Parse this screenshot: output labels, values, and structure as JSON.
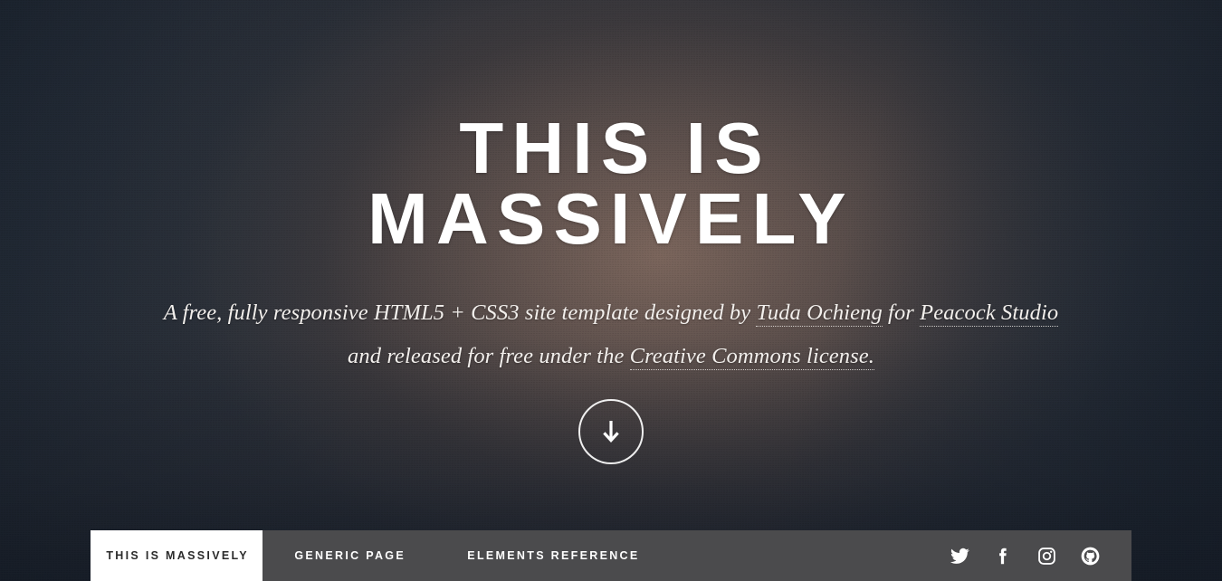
{
  "hero": {
    "title": "THIS IS MASSIVELY",
    "title_line1": "THIS IS",
    "title_line2": "MASSIVELY",
    "subtitle_line1_pre": "A free, fully responsive HTML5 + CSS3 site template designed by ",
    "subtitle_link_author": "Tuda Ochieng",
    "subtitle_line1_mid": " for ",
    "subtitle_link_studio": "Peacock Studio",
    "subtitle_line2_pre": "and released for free under the ",
    "subtitle_link_license": "Creative Commons license.",
    "scroll_button_label": "Scroll down",
    "scroll_icon": "arrow-down-icon"
  },
  "nav": {
    "items": [
      {
        "label": "This is Massively",
        "active": true
      },
      {
        "label": "Generic Page",
        "active": false
      },
      {
        "label": "Elements Reference",
        "active": false
      }
    ],
    "social": [
      {
        "name": "twitter",
        "label": "Twitter"
      },
      {
        "name": "facebook",
        "label": "Facebook"
      },
      {
        "name": "instagram",
        "label": "Instagram"
      },
      {
        "name": "github",
        "label": "GitHub"
      }
    ]
  },
  "colors": {
    "nav_background": "#4b4b4d",
    "nav_active_background": "#ffffff",
    "nav_active_text": "#2b2b2b",
    "page_background": "#1e2530",
    "hero_warm": "#7a645a",
    "text_light": "#ffffff"
  }
}
